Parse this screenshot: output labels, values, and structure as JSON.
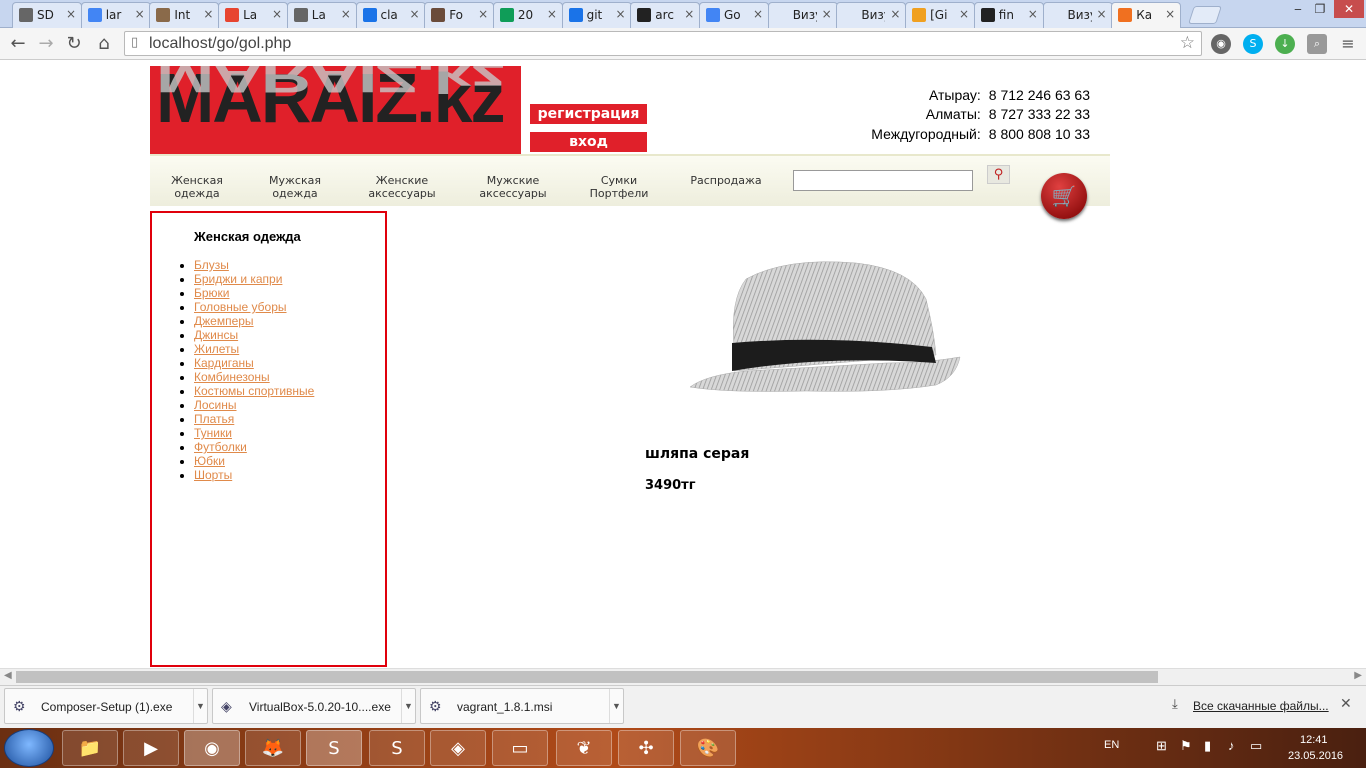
{
  "tabs": [
    {
      "label": "SD",
      "icon": "document-icon",
      "color": "#666666"
    },
    {
      "label": "lar",
      "icon": "google-icon",
      "color": "#4285f4"
    },
    {
      "label": "Int",
      "icon": "avatar-icon",
      "color": "#8a6a4a"
    },
    {
      "label": "La",
      "icon": "laravel-icon",
      "color": "#e74430"
    },
    {
      "label": "La",
      "icon": "document-icon",
      "color": "#666666"
    },
    {
      "label": "cla",
      "icon": "search-q-icon",
      "color": "#1a73e8"
    },
    {
      "label": "Fo",
      "icon": "profile-icon",
      "color": "#6b4c3b"
    },
    {
      "label": "20",
      "icon": "sheets-icon",
      "color": "#0f9d58"
    },
    {
      "label": "git",
      "icon": "search-q-icon",
      "color": "#1a73e8"
    },
    {
      "label": "arc",
      "icon": "github-icon",
      "color": "#222222"
    },
    {
      "label": "Go",
      "icon": "google-icon",
      "color": "#4285f4"
    },
    {
      "label": "Визуа",
      "icon": "blank-icon",
      "color": "#dfe8f7"
    },
    {
      "label": "Визуа",
      "icon": "blank-icon",
      "color": "#dfe8f7"
    },
    {
      "label": "[Gi",
      "icon": "at-icon",
      "color": "#f0a020"
    },
    {
      "label": "fin",
      "icon": "github-icon",
      "color": "#222222"
    },
    {
      "label": "Визуа",
      "icon": "blank-icon",
      "color": "#dfe8f7"
    },
    {
      "label": "Ка",
      "icon": "xampp-icon",
      "color": "#f07020"
    }
  ],
  "browser": {
    "url": "localhost/go/gol.php",
    "tab_close": "×"
  },
  "site": {
    "logo": "MARAIZ.kz",
    "register": "регистрация",
    "login": "вход",
    "phones": [
      {
        "city": "Атырау:",
        "number": "8 712 246 63 63"
      },
      {
        "city": "Алматы:",
        "number": "8 727 333 22 33"
      },
      {
        "city": "Междугородный:",
        "number": "8 800 808 10 33"
      }
    ],
    "menu": [
      {
        "line1": "Женская",
        "line2": "одежда"
      },
      {
        "line1": "Мужская",
        "line2": "одежда"
      },
      {
        "line1": "Женские",
        "line2": "аксессуары"
      },
      {
        "line1": "Мужские",
        "line2": "аксессуары"
      },
      {
        "line1": "Сумки",
        "line2": "Портфели"
      },
      {
        "line1": "Распродажа",
        "line2": ""
      }
    ],
    "search_value": ""
  },
  "sidebar": {
    "title": "Женская одежда",
    "items": [
      "Блузы",
      "Бриджи и капри",
      "Брюки",
      "Головные уборы",
      "Джемперы",
      "Джинсы",
      "Жилеты",
      "Кардиганы",
      "Комбинезоны",
      "Костюмы спортивные",
      "Лосины",
      "Платья",
      "Туники",
      "Футболки",
      "Юбки",
      "Шорты"
    ]
  },
  "product": {
    "name": "шляпа серая",
    "price": "3490тг"
  },
  "downloads": {
    "items": [
      "Composer-Setup (1).exe",
      "VirtualBox-5.0.20-10....exe",
      "vagrant_1.8.1.msi"
    ],
    "show_all": "Все скачанные файлы..."
  },
  "taskbar": {
    "lang": "EN",
    "time": "12:41",
    "date": "23.05.2016"
  },
  "colors": {
    "brand_red": "#e0202a",
    "link": "#e08a4a"
  }
}
